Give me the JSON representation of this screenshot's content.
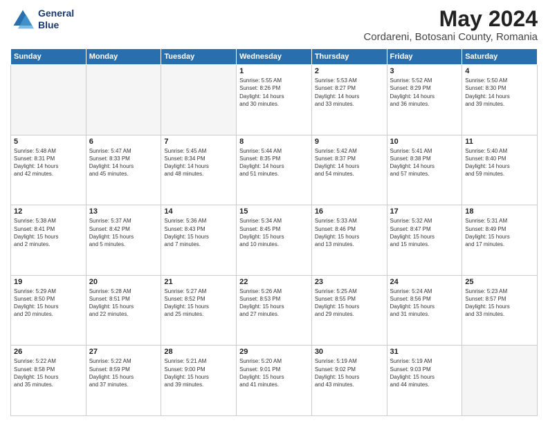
{
  "header": {
    "logo_line1": "General",
    "logo_line2": "Blue",
    "main_title": "May 2024",
    "sub_title": "Cordareni, Botosani County, Romania"
  },
  "weekdays": [
    "Sunday",
    "Monday",
    "Tuesday",
    "Wednesday",
    "Thursday",
    "Friday",
    "Saturday"
  ],
  "weeks": [
    [
      {
        "day": "",
        "info": ""
      },
      {
        "day": "",
        "info": ""
      },
      {
        "day": "",
        "info": ""
      },
      {
        "day": "1",
        "info": "Sunrise: 5:55 AM\nSunset: 8:26 PM\nDaylight: 14 hours\nand 30 minutes."
      },
      {
        "day": "2",
        "info": "Sunrise: 5:53 AM\nSunset: 8:27 PM\nDaylight: 14 hours\nand 33 minutes."
      },
      {
        "day": "3",
        "info": "Sunrise: 5:52 AM\nSunset: 8:29 PM\nDaylight: 14 hours\nand 36 minutes."
      },
      {
        "day": "4",
        "info": "Sunrise: 5:50 AM\nSunset: 8:30 PM\nDaylight: 14 hours\nand 39 minutes."
      }
    ],
    [
      {
        "day": "5",
        "info": "Sunrise: 5:48 AM\nSunset: 8:31 PM\nDaylight: 14 hours\nand 42 minutes."
      },
      {
        "day": "6",
        "info": "Sunrise: 5:47 AM\nSunset: 8:33 PM\nDaylight: 14 hours\nand 45 minutes."
      },
      {
        "day": "7",
        "info": "Sunrise: 5:45 AM\nSunset: 8:34 PM\nDaylight: 14 hours\nand 48 minutes."
      },
      {
        "day": "8",
        "info": "Sunrise: 5:44 AM\nSunset: 8:35 PM\nDaylight: 14 hours\nand 51 minutes."
      },
      {
        "day": "9",
        "info": "Sunrise: 5:42 AM\nSunset: 8:37 PM\nDaylight: 14 hours\nand 54 minutes."
      },
      {
        "day": "10",
        "info": "Sunrise: 5:41 AM\nSunset: 8:38 PM\nDaylight: 14 hours\nand 57 minutes."
      },
      {
        "day": "11",
        "info": "Sunrise: 5:40 AM\nSunset: 8:40 PM\nDaylight: 14 hours\nand 59 minutes."
      }
    ],
    [
      {
        "day": "12",
        "info": "Sunrise: 5:38 AM\nSunset: 8:41 PM\nDaylight: 15 hours\nand 2 minutes."
      },
      {
        "day": "13",
        "info": "Sunrise: 5:37 AM\nSunset: 8:42 PM\nDaylight: 15 hours\nand 5 minutes."
      },
      {
        "day": "14",
        "info": "Sunrise: 5:36 AM\nSunset: 8:43 PM\nDaylight: 15 hours\nand 7 minutes."
      },
      {
        "day": "15",
        "info": "Sunrise: 5:34 AM\nSunset: 8:45 PM\nDaylight: 15 hours\nand 10 minutes."
      },
      {
        "day": "16",
        "info": "Sunrise: 5:33 AM\nSunset: 8:46 PM\nDaylight: 15 hours\nand 13 minutes."
      },
      {
        "day": "17",
        "info": "Sunrise: 5:32 AM\nSunset: 8:47 PM\nDaylight: 15 hours\nand 15 minutes."
      },
      {
        "day": "18",
        "info": "Sunrise: 5:31 AM\nSunset: 8:49 PM\nDaylight: 15 hours\nand 17 minutes."
      }
    ],
    [
      {
        "day": "19",
        "info": "Sunrise: 5:29 AM\nSunset: 8:50 PM\nDaylight: 15 hours\nand 20 minutes."
      },
      {
        "day": "20",
        "info": "Sunrise: 5:28 AM\nSunset: 8:51 PM\nDaylight: 15 hours\nand 22 minutes."
      },
      {
        "day": "21",
        "info": "Sunrise: 5:27 AM\nSunset: 8:52 PM\nDaylight: 15 hours\nand 25 minutes."
      },
      {
        "day": "22",
        "info": "Sunrise: 5:26 AM\nSunset: 8:53 PM\nDaylight: 15 hours\nand 27 minutes."
      },
      {
        "day": "23",
        "info": "Sunrise: 5:25 AM\nSunset: 8:55 PM\nDaylight: 15 hours\nand 29 minutes."
      },
      {
        "day": "24",
        "info": "Sunrise: 5:24 AM\nSunset: 8:56 PM\nDaylight: 15 hours\nand 31 minutes."
      },
      {
        "day": "25",
        "info": "Sunrise: 5:23 AM\nSunset: 8:57 PM\nDaylight: 15 hours\nand 33 minutes."
      }
    ],
    [
      {
        "day": "26",
        "info": "Sunrise: 5:22 AM\nSunset: 8:58 PM\nDaylight: 15 hours\nand 35 minutes."
      },
      {
        "day": "27",
        "info": "Sunrise: 5:22 AM\nSunset: 8:59 PM\nDaylight: 15 hours\nand 37 minutes."
      },
      {
        "day": "28",
        "info": "Sunrise: 5:21 AM\nSunset: 9:00 PM\nDaylight: 15 hours\nand 39 minutes."
      },
      {
        "day": "29",
        "info": "Sunrise: 5:20 AM\nSunset: 9:01 PM\nDaylight: 15 hours\nand 41 minutes."
      },
      {
        "day": "30",
        "info": "Sunrise: 5:19 AM\nSunset: 9:02 PM\nDaylight: 15 hours\nand 43 minutes."
      },
      {
        "day": "31",
        "info": "Sunrise: 5:19 AM\nSunset: 9:03 PM\nDaylight: 15 hours\nand 44 minutes."
      },
      {
        "day": "",
        "info": ""
      }
    ]
  ]
}
